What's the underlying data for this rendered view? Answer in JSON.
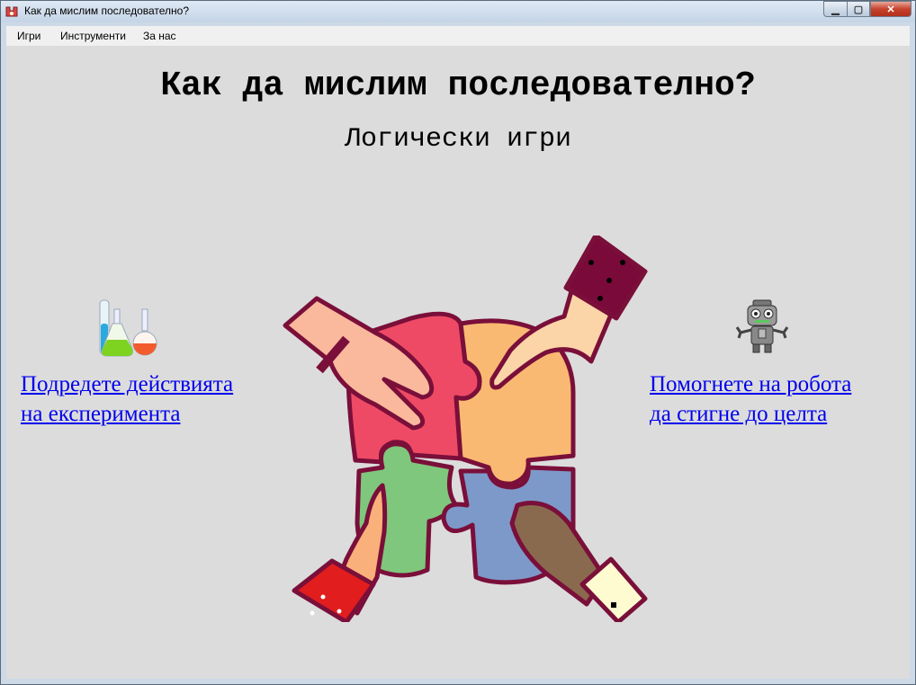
{
  "window": {
    "title": "Как да мислим последователно?",
    "minimize_label": "▁",
    "maximize_label": "▢",
    "close_label": "✕"
  },
  "menu": [
    "Игри",
    "Инструменти",
    "За нас"
  ],
  "main": {
    "title": "Как да мислим последователно?",
    "subtitle": "Логически игри",
    "left_link_line1": "Подредете действията",
    "left_link_line2": "на експеримента",
    "right_link_line1": "Помогнете на робота",
    "right_link_line2": "да стигне до целта"
  },
  "icons": {
    "left": "lab-flasks-icon",
    "right": "robot-icon",
    "center": "puzzle-hands-illustration"
  },
  "colors": {
    "link": "#0000ee",
    "background": "#dcdcdc"
  }
}
